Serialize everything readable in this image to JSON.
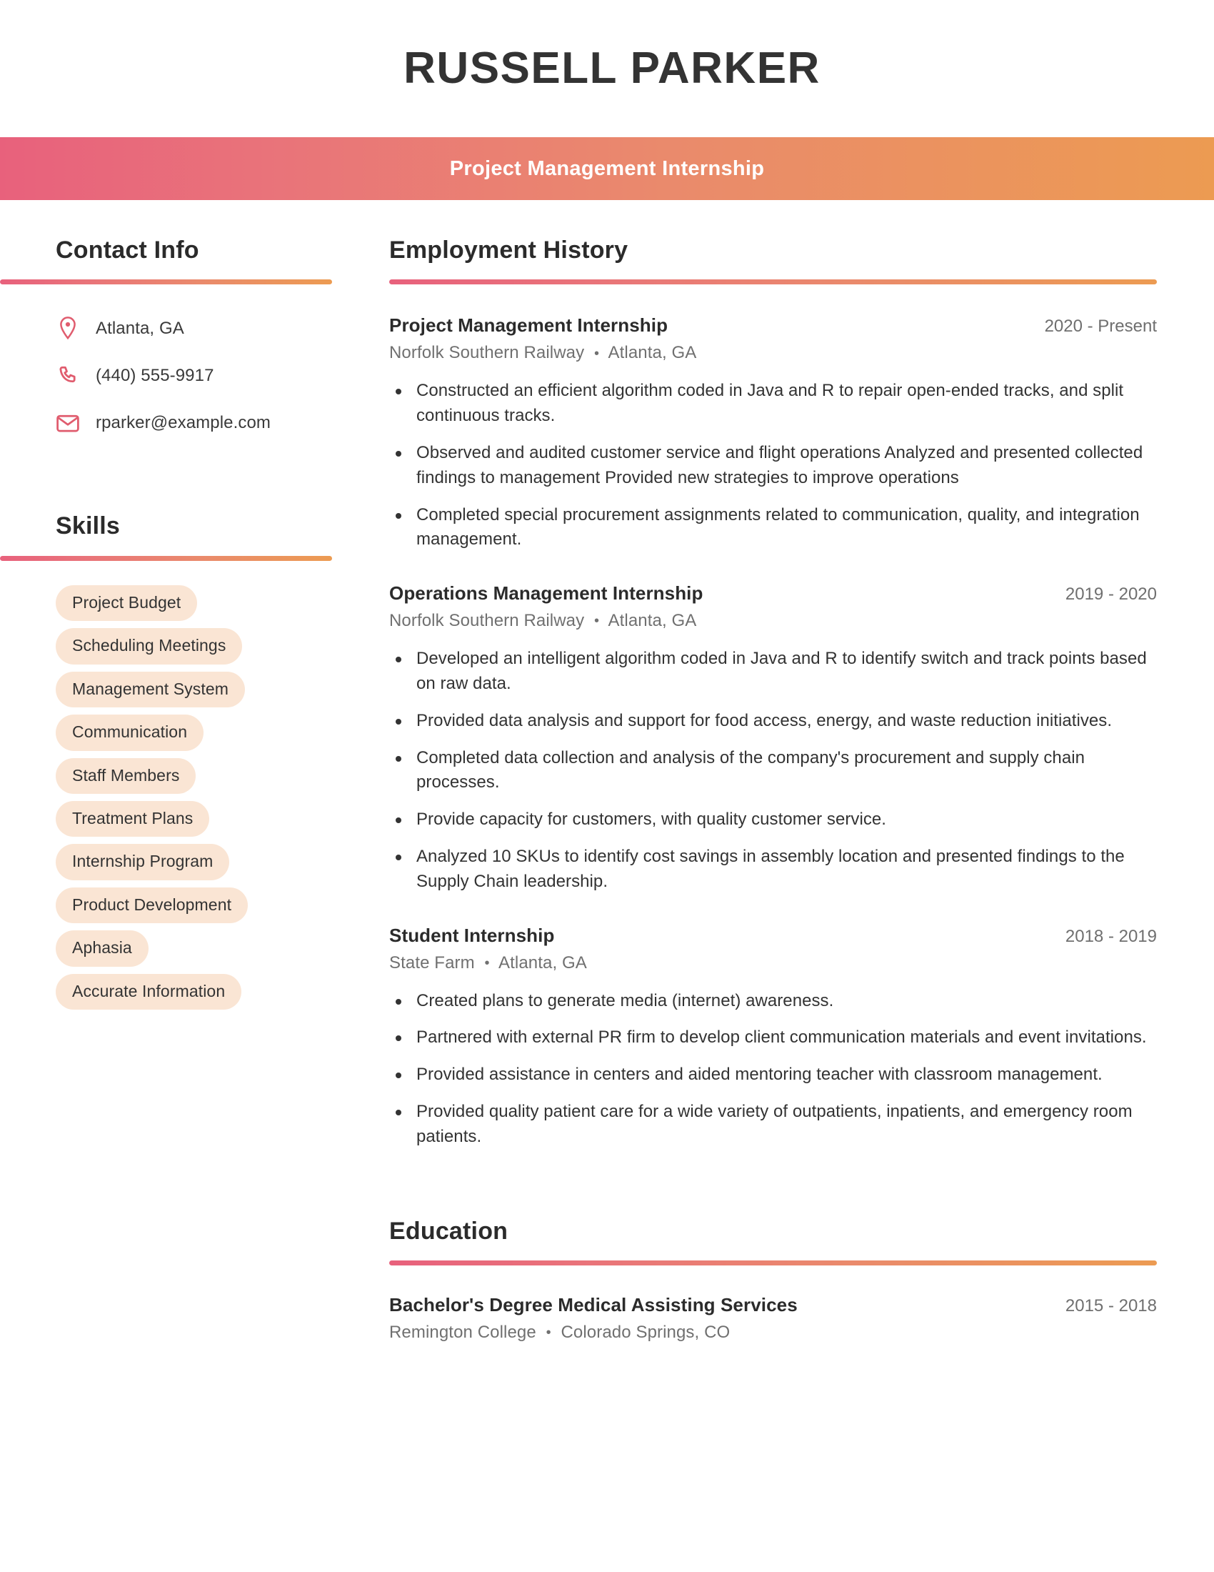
{
  "header": {
    "full_name": "RUSSELL PARKER",
    "job_title": "Project Management Internship",
    "gradient_start": "#e8617c",
    "gradient_end": "#ec9b52"
  },
  "sidebar": {
    "contact": {
      "heading": "Contact Info",
      "items": [
        {
          "icon": "location-pin-icon",
          "value": "Atlanta, GA"
        },
        {
          "icon": "phone-icon",
          "value": "(440) 555-9917"
        },
        {
          "icon": "envelope-icon",
          "value": "rparker@example.com"
        }
      ]
    },
    "skills": {
      "heading": "Skills",
      "pill_color": "#fae5d4",
      "items": [
        "Project Budget",
        "Scheduling Meetings",
        "Management System",
        "Communication",
        "Staff Members",
        "Treatment Plans",
        "Internship Program",
        "Product Development",
        "Aphasia",
        "Accurate Information"
      ]
    }
  },
  "main": {
    "employment": {
      "heading": "Employment History",
      "entries": [
        {
          "title": "Project Management Internship",
          "dates": "2020 - Present",
          "company": "Norfolk Southern Railway",
          "location": "Atlanta, GA",
          "bullets": [
            "Constructed an efficient algorithm coded in Java and R to repair open-ended tracks, and split continuous tracks.",
            "Observed and audited customer service and flight operations Analyzed and presented collected findings to management Provided new strategies to improve operations",
            "Completed special procurement assignments related to communication, quality, and integration management."
          ]
        },
        {
          "title": "Operations Management Internship",
          "dates": "2019 - 2020",
          "company": "Norfolk Southern Railway",
          "location": "Atlanta, GA",
          "bullets": [
            "Developed an intelligent algorithm coded in Java and R to identify switch and track points based on raw data.",
            "Provided data analysis and support for food access, energy, and waste reduction initiatives.",
            "Completed data collection and analysis of the company's procurement and supply chain processes.",
            "Provide capacity for customers, with quality customer service.",
            "Analyzed 10 SKUs to identify cost savings in assembly location and presented findings to the Supply Chain leadership."
          ]
        },
        {
          "title": "Student Internship",
          "dates": "2018 - 2019",
          "company": "State Farm",
          "location": "Atlanta, GA",
          "bullets": [
            "Created plans to generate media (internet) awareness.",
            "Partnered with external PR firm to develop client communication materials and event invitations.",
            "Provided assistance in centers and aided mentoring teacher with classroom management.",
            "Provided quality patient care for a wide variety of outpatients, inpatients, and emergency room patients."
          ]
        }
      ]
    },
    "education": {
      "heading": "Education",
      "entries": [
        {
          "title": "Bachelor's Degree Medical Assisting Services",
          "dates": "2015 - 2018",
          "school": "Remington College",
          "location": "Colorado Springs, CO"
        }
      ]
    }
  }
}
